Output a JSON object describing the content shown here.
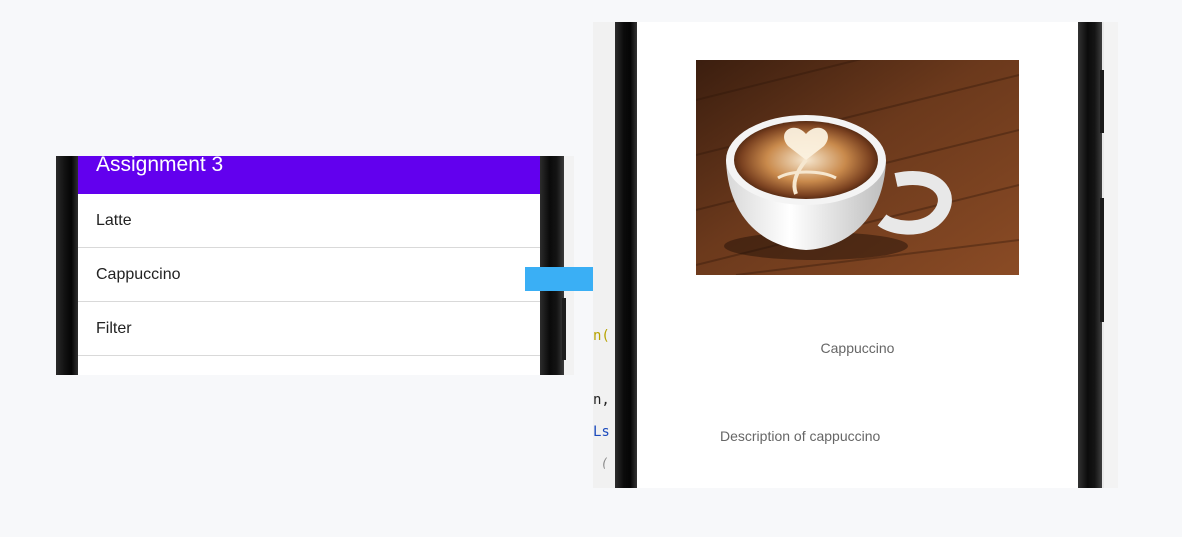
{
  "list_screen": {
    "app_title": "Assignment 3",
    "items": [
      {
        "label": "Latte"
      },
      {
        "label": "Cappuccino"
      },
      {
        "label": "Filter"
      }
    ]
  },
  "detail_screen": {
    "image_icon": "coffee-cup-image",
    "name": "Cappuccino",
    "description": "Description of cappuccino"
  },
  "ide_fragments": [
    "n(",
    "n,",
    "Ls",
    "("
  ],
  "colors": {
    "app_bar": "#6200ee",
    "arrow": "#3aaff5",
    "background": "#f7f8fa"
  }
}
